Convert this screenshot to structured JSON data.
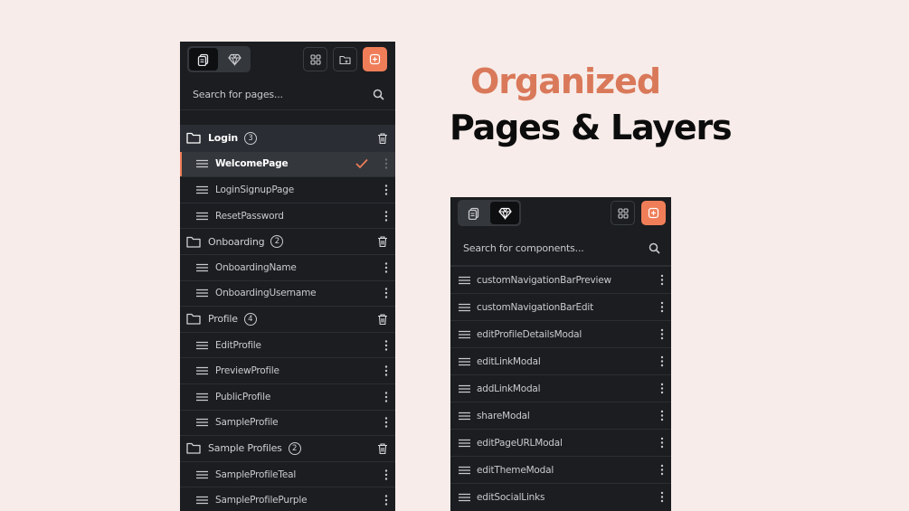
{
  "headline": {
    "line1": "Organized",
    "line2": "Pages & Layers"
  },
  "colors": {
    "background": "#f7ece9",
    "accent": "#ef7e58",
    "panel": "#1b1d20",
    "headline_accent": "#d9795a"
  },
  "pages_panel": {
    "search_placeholder": "Search for pages...",
    "tabs": [
      {
        "icon": "pages-icon",
        "active": true
      },
      {
        "icon": "components-icon",
        "active": false
      }
    ],
    "toolbar_icons": [
      "grid-icon",
      "folder-add-icon",
      "add-page-icon"
    ],
    "folders": [
      {
        "name": "Login",
        "count": "3",
        "pages": [
          {
            "name": "WelcomePage",
            "active": true
          },
          {
            "name": "LoginSignupPage"
          },
          {
            "name": "ResetPassword"
          }
        ]
      },
      {
        "name": "Onboarding",
        "count": "2",
        "pages": [
          {
            "name": "OnboardingName"
          },
          {
            "name": "OnboardingUsername"
          }
        ]
      },
      {
        "name": "Profile",
        "count": "4",
        "pages": [
          {
            "name": "EditProfile"
          },
          {
            "name": "PreviewProfile"
          },
          {
            "name": "PublicProfile"
          },
          {
            "name": "SampleProfile"
          }
        ]
      },
      {
        "name": "Sample Profiles",
        "count": "2",
        "pages": [
          {
            "name": "SampleProfileTeal"
          },
          {
            "name": "SampleProfilePurple"
          }
        ]
      }
    ]
  },
  "components_panel": {
    "search_placeholder": "Search for components...",
    "tabs": [
      {
        "icon": "pages-icon",
        "active": false
      },
      {
        "icon": "components-icon",
        "active": true
      }
    ],
    "toolbar_icons": [
      "grid-icon",
      "add-component-icon"
    ],
    "components": [
      "customNavigationBarPreview",
      "customNavigationBarEdit",
      "editProfileDetailsModal",
      "editLinkModal",
      "addLinkModal",
      "shareModal",
      "editPageURLModal",
      "editThemeModal",
      "editSocialLinks"
    ]
  }
}
